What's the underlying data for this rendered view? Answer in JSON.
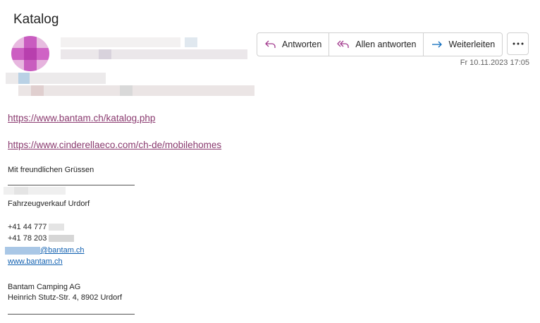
{
  "subject": "Katalog",
  "toolbar": {
    "reply_label": "Antworten",
    "reply_all_label": "Allen antworten",
    "forward_label": "Weiterleiten",
    "more_icon": "more-icon",
    "colors": {
      "reply_icon": "#a23b8e",
      "forward_icon": "#0f6cbd"
    }
  },
  "date": "Fr 10.11.2023 17:05",
  "body": {
    "link1": "https://www.bantam.ch/katalog.php",
    "link2": "https://www.cinderellaeco.com/ch-de/mobilehomes",
    "greeting": "Mit freundlichen Grüssen",
    "department": "Fahrzeugverkauf Urdorf",
    "phone1": "+41 44 777 ",
    "phone2": "+41 78 203 ",
    "email_suffix": "@bantam.ch",
    "website": "www.bantam.ch",
    "company": "Bantam Camping AG",
    "address": "Heinrich Stutz-Str. 4, 8902 Urdorf"
  }
}
